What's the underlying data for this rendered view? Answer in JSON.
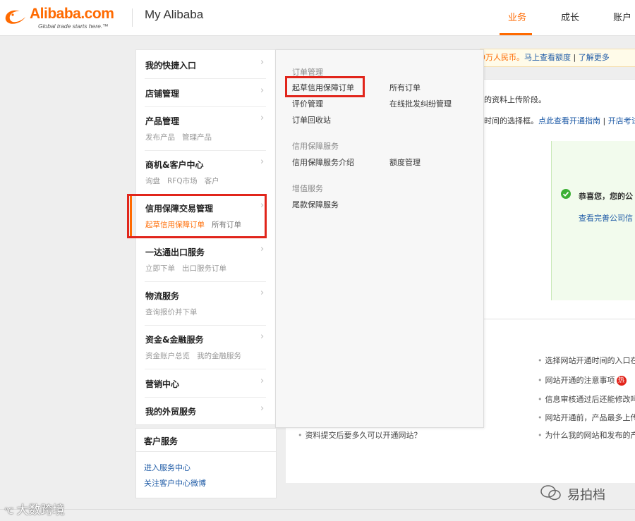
{
  "header": {
    "logo_word": "Alibaba.com",
    "logo_tag": "Global trade starts here.™",
    "title": "My Alibaba",
    "nav": [
      "业务",
      "成长",
      "账户"
    ],
    "active_nav": "业务",
    "accent_color": "#ff6a00"
  },
  "notice": {
    "prefix": "0万人民币。",
    "link1": "马上查看额度",
    "sep": " | ",
    "link2": "了解更多"
  },
  "content": {
    "line1": "的资料上传阶段。",
    "line2_prefix": "时间的选择框。",
    "line2_link1": "点此查看开通指南",
    "line2_sep": " | ",
    "line2_link2": "开店考试"
  },
  "success_panel": {
    "congrats": "恭喜您，您的公",
    "view_link": "查看完善公司信"
  },
  "faq": {
    "right": [
      "选择网站开通时间的入口在",
      "网站开通的注意事项",
      "信息审核通过后还能修改吗",
      "网站开通前，产品最多上传",
      "为什么我的网站和发布的产"
    ],
    "hot_badge": "热",
    "left": "资料提交后要多久可以开通网站？"
  },
  "menu": {
    "items": [
      {
        "title": "我的快捷入口",
        "subs": []
      },
      {
        "title": "店铺管理",
        "subs": []
      },
      {
        "title": "产品管理",
        "subs": [
          "发布产品",
          "管理产品"
        ]
      },
      {
        "title": "商机&客户中心",
        "subs": [
          "询盘",
          "RFQ市场",
          "客户"
        ]
      },
      {
        "title": "信用保障交易管理",
        "subs": [
          "起草信用保障订单",
          "所有订单"
        ]
      },
      {
        "title": "一达通出口服务",
        "subs": [
          "立即下单",
          "出口服务订单"
        ]
      },
      {
        "title": "物流服务",
        "subs": [
          "查询报价并下单"
        ]
      },
      {
        "title": "资金&金融服务",
        "subs": [
          "资金账户总览",
          "我的金融服务"
        ]
      },
      {
        "title": "营销中心",
        "subs": []
      },
      {
        "title": "我的外贸服务",
        "subs": []
      }
    ],
    "chevron": "›"
  },
  "flyout": {
    "sections": [
      {
        "header": "订单管理",
        "links": [
          "起草信用保障订单",
          "所有订单",
          "评价管理",
          "在线批发纠纷管理",
          "订单回收站"
        ]
      },
      {
        "header": "信用保障服务",
        "links": [
          "信用保障服务介绍",
          "额度管理"
        ]
      },
      {
        "header": "增值服务",
        "links": [
          "尾款保障服务"
        ]
      }
    ]
  },
  "service": {
    "title": "客户服务",
    "links": [
      "进入服务中心",
      "关注客户中心微博"
    ]
  },
  "watermarks": {
    "bottom_right": "易拍档",
    "bottom_left": "大数跨境"
  }
}
